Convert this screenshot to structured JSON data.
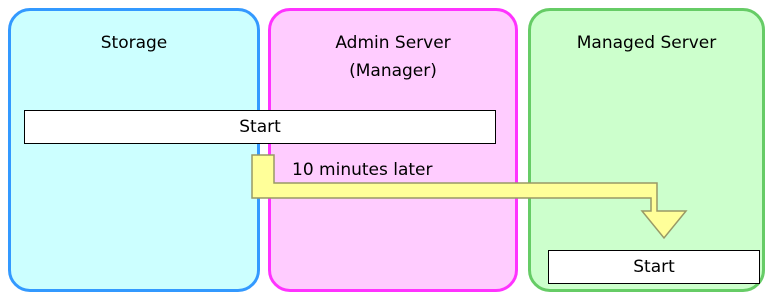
{
  "lanes": {
    "storage": {
      "title": "Storage"
    },
    "admin": {
      "title": "Admin Server\n(Manager)"
    },
    "managed": {
      "title": "Managed Server"
    }
  },
  "steps": {
    "start_1": "Start",
    "delay": "10 minutes later",
    "start_2": "Start"
  },
  "colors": {
    "storage_fill": "#ccffff",
    "storage_border": "#3399ff",
    "admin_fill": "#ffccff",
    "admin_border": "#ff33ff",
    "managed_fill": "#ccffcc",
    "managed_border": "#66cc66",
    "arrow_fill": "#ffff99",
    "arrow_border": "#999966"
  }
}
